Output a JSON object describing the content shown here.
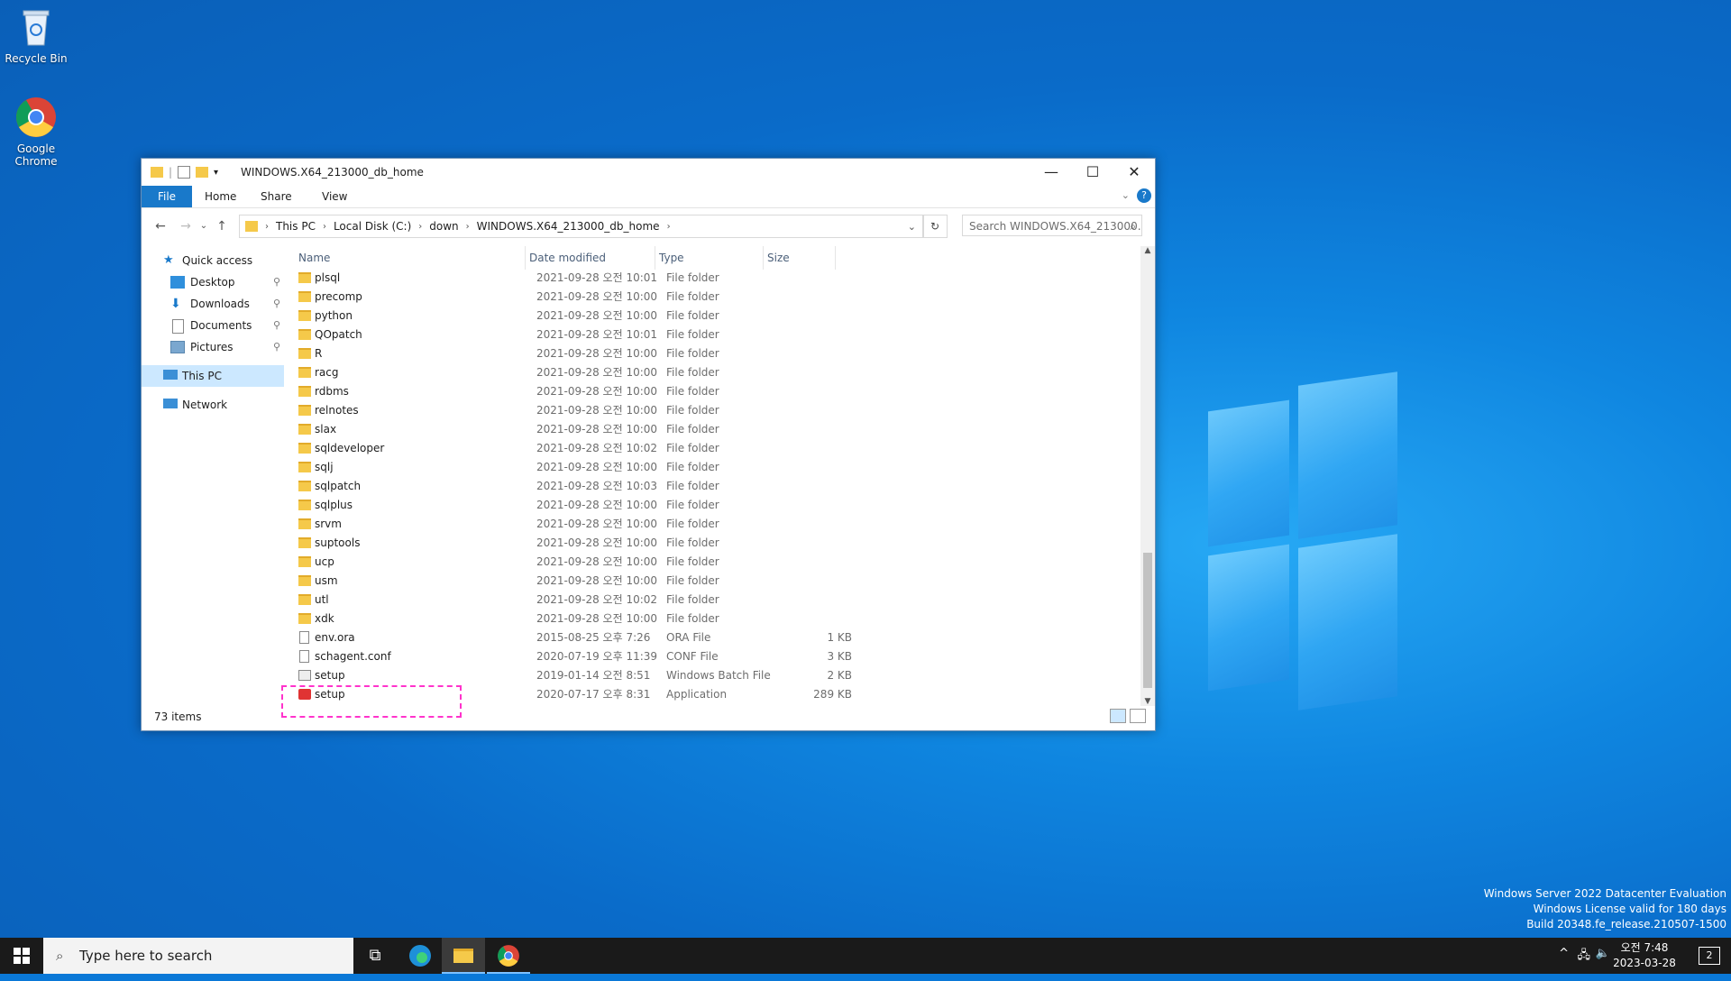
{
  "desktop": {
    "icons": [
      {
        "label": "Recycle Bin"
      },
      {
        "label": "Google Chrome"
      }
    ],
    "watermark": {
      "line1": "Windows Server 2022 Datacenter Evaluation",
      "line2": "Windows License valid for 180 days",
      "line3": "Build 20348.fe_release.210507-1500"
    }
  },
  "explorer": {
    "title": "WINDOWS.X64_213000_db_home",
    "ribbon_tabs": [
      "File",
      "Home",
      "Share",
      "View"
    ],
    "breadcrumb": [
      "This PC",
      "Local Disk (C:)",
      "down",
      "WINDOWS.X64_213000_db_home"
    ],
    "search_placeholder": "Search WINDOWS.X64_213000...",
    "nav": {
      "quick_access": "Quick access",
      "desktop": "Desktop",
      "downloads": "Downloads",
      "documents": "Documents",
      "pictures": "Pictures",
      "this_pc": "This PC",
      "network": "Network"
    },
    "columns": {
      "name": "Name",
      "date": "Date modified",
      "type": "Type",
      "size": "Size"
    },
    "files": [
      {
        "name": "plsql",
        "date": "2021-09-28 오전 10:01",
        "type": "File folder",
        "size": "",
        "icon": "folder"
      },
      {
        "name": "precomp",
        "date": "2021-09-28 오전 10:00",
        "type": "File folder",
        "size": "",
        "icon": "folder"
      },
      {
        "name": "python",
        "date": "2021-09-28 오전 10:00",
        "type": "File folder",
        "size": "",
        "icon": "folder"
      },
      {
        "name": "QOpatch",
        "date": "2021-09-28 오전 10:01",
        "type": "File folder",
        "size": "",
        "icon": "folder"
      },
      {
        "name": "R",
        "date": "2021-09-28 오전 10:00",
        "type": "File folder",
        "size": "",
        "icon": "folder"
      },
      {
        "name": "racg",
        "date": "2021-09-28 오전 10:00",
        "type": "File folder",
        "size": "",
        "icon": "folder"
      },
      {
        "name": "rdbms",
        "date": "2021-09-28 오전 10:00",
        "type": "File folder",
        "size": "",
        "icon": "folder"
      },
      {
        "name": "relnotes",
        "date": "2021-09-28 오전 10:00",
        "type": "File folder",
        "size": "",
        "icon": "folder"
      },
      {
        "name": "slax",
        "date": "2021-09-28 오전 10:00",
        "type": "File folder",
        "size": "",
        "icon": "folder"
      },
      {
        "name": "sqldeveloper",
        "date": "2021-09-28 오전 10:02",
        "type": "File folder",
        "size": "",
        "icon": "folder"
      },
      {
        "name": "sqlj",
        "date": "2021-09-28 오전 10:00",
        "type": "File folder",
        "size": "",
        "icon": "folder"
      },
      {
        "name": "sqlpatch",
        "date": "2021-09-28 오전 10:03",
        "type": "File folder",
        "size": "",
        "icon": "folder"
      },
      {
        "name": "sqlplus",
        "date": "2021-09-28 오전 10:00",
        "type": "File folder",
        "size": "",
        "icon": "folder"
      },
      {
        "name": "srvm",
        "date": "2021-09-28 오전 10:00",
        "type": "File folder",
        "size": "",
        "icon": "folder"
      },
      {
        "name": "suptools",
        "date": "2021-09-28 오전 10:00",
        "type": "File folder",
        "size": "",
        "icon": "folder"
      },
      {
        "name": "ucp",
        "date": "2021-09-28 오전 10:00",
        "type": "File folder",
        "size": "",
        "icon": "folder"
      },
      {
        "name": "usm",
        "date": "2021-09-28 오전 10:00",
        "type": "File folder",
        "size": "",
        "icon": "folder"
      },
      {
        "name": "utl",
        "date": "2021-09-28 오전 10:02",
        "type": "File folder",
        "size": "",
        "icon": "folder"
      },
      {
        "name": "xdk",
        "date": "2021-09-28 오전 10:00",
        "type": "File folder",
        "size": "",
        "icon": "folder"
      },
      {
        "name": "env.ora",
        "date": "2015-08-25 오후 7:26",
        "type": "ORA File",
        "size": "1 KB",
        "icon": "doc"
      },
      {
        "name": "schagent.conf",
        "date": "2020-07-19 오후 11:39",
        "type": "CONF File",
        "size": "3 KB",
        "icon": "doc"
      },
      {
        "name": "setup",
        "date": "2019-01-14 오전 8:51",
        "type": "Windows Batch File",
        "size": "2 KB",
        "icon": "bat"
      },
      {
        "name": "setup",
        "date": "2020-07-17 오후 8:31",
        "type": "Application",
        "size": "289 KB",
        "icon": "app"
      }
    ],
    "status": "73 items"
  },
  "taskbar": {
    "search_placeholder": "Type here to search",
    "time": "오전 7:48",
    "date": "2023-03-28",
    "notifications": "2"
  }
}
